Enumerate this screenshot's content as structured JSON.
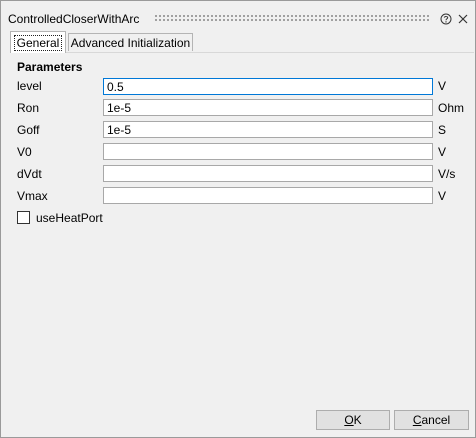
{
  "window": {
    "title": "ControlledCloserWithArc"
  },
  "tabs": [
    {
      "label": "General",
      "active": true
    },
    {
      "label": "Advanced Initialization",
      "active": false
    }
  ],
  "parameters": {
    "header": "Parameters",
    "rows": [
      {
        "label": "level",
        "value": "0.5",
        "unit": "V"
      },
      {
        "label": "Ron",
        "value": "1e-5",
        "unit": "Ohm"
      },
      {
        "label": "Goff",
        "value": "1e-5",
        "unit": "S"
      },
      {
        "label": "V0",
        "value": "",
        "unit": "V"
      },
      {
        "label": "dVdt",
        "value": "",
        "unit": "V/s"
      },
      {
        "label": "Vmax",
        "value": "",
        "unit": "V"
      }
    ]
  },
  "options": {
    "use_heat_port_label": "useHeatPort",
    "use_heat_port_checked": false
  },
  "buttons": {
    "ok_mnemonic": "O",
    "ok_rest": "K",
    "cancel_mnemonic": "C",
    "cancel_rest": "ancel"
  },
  "icons": {
    "help": "help-icon",
    "close": "close-icon"
  },
  "colors": {
    "background": "#f0f0f0",
    "focus_border": "#0078d7",
    "button_face": "#e1e1e1"
  }
}
